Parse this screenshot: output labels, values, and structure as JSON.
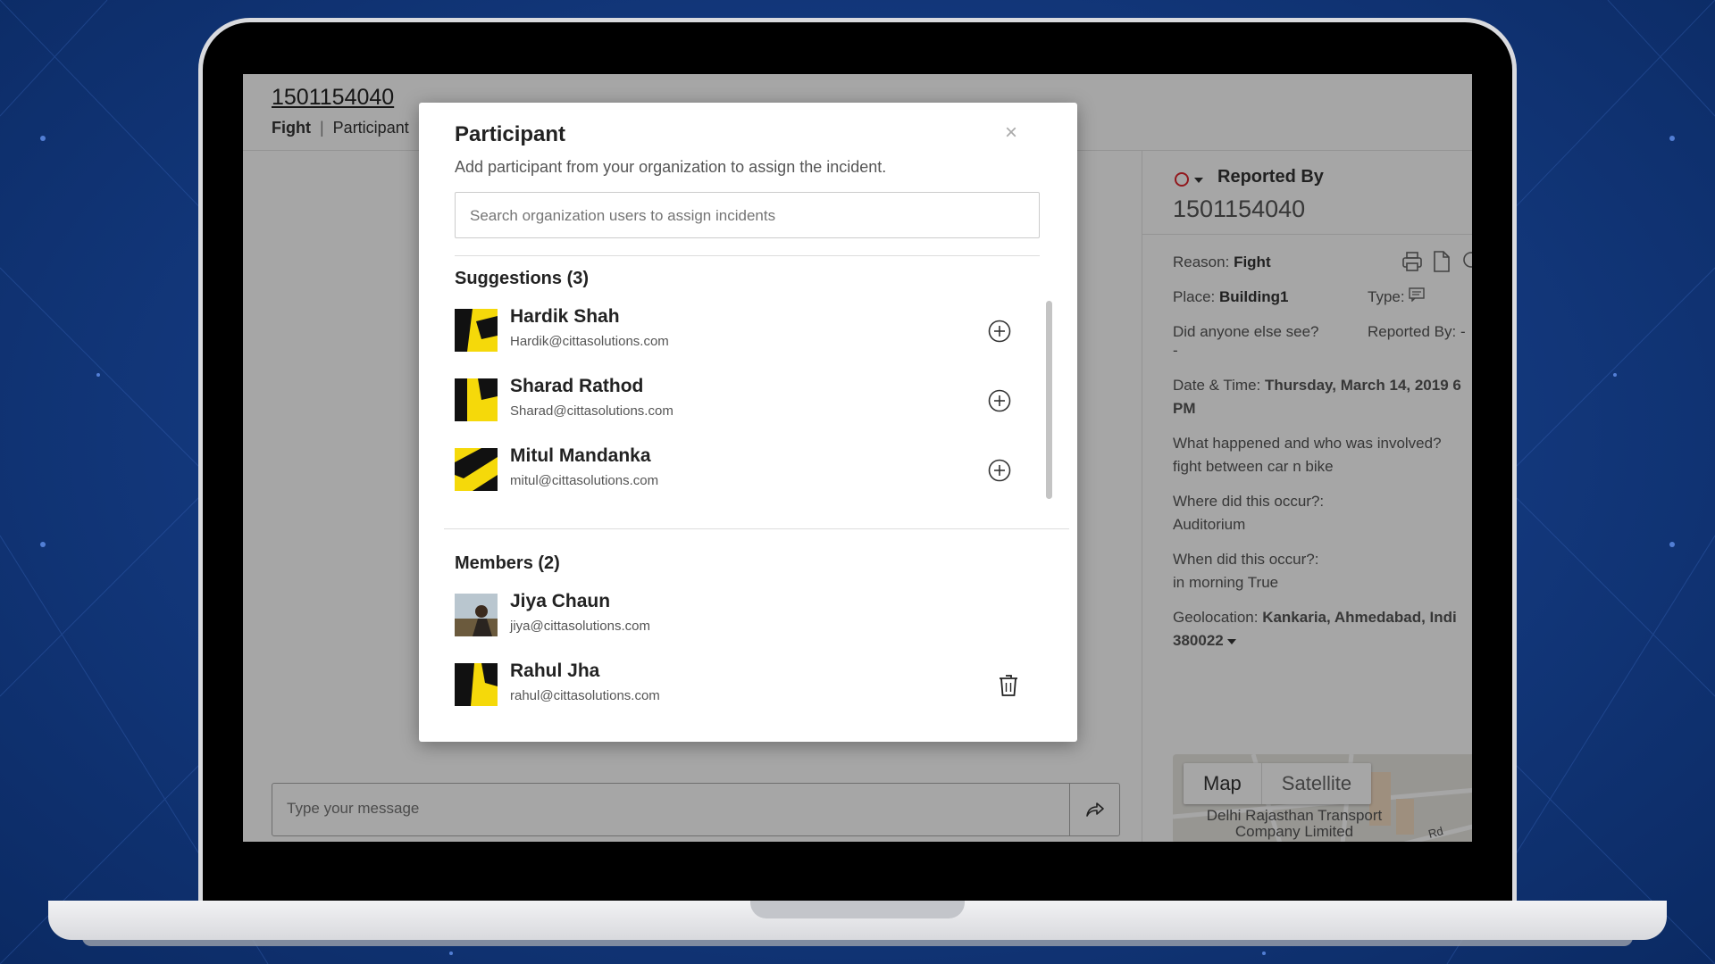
{
  "incident": {
    "id": "1501154040",
    "nav": {
      "active": "Fight",
      "separator": "|",
      "item": "Participant"
    }
  },
  "chat": {
    "message_placeholder": "Type your message",
    "send_icon": "share-arrow-icon"
  },
  "right_panel": {
    "reported_by_title": "Reported By",
    "reported_by_value": "1501154040",
    "status_color": "#e0262d",
    "reason_label": "Reason:",
    "reason_value": "Fight",
    "place_label": "Place:",
    "place_value": "Building1",
    "type_label": "Type:",
    "did_anyone_else_see": "Did anyone else see?",
    "did_anyone_else_see_value": "-",
    "reported_by_label": "Reported By: -",
    "date_time_label": "Date & Time:",
    "date_time_value": "Thursday, March 14, 2019 6",
    "date_time_value2": "PM",
    "what_happened_q": "What happened and who was involved?",
    "what_happened_a": "fight between car n bike",
    "where_q": "Where did this occur?:",
    "where_a": "Auditorium",
    "when_q": "When did this occur?:",
    "when_a": "in morning True",
    "geo_label": "Geolocation:",
    "geo_value": "Kankaria, Ahmedabad, Indi",
    "geo_value2": "380022"
  },
  "map": {
    "tab_map": "Map",
    "tab_satellite": "Satellite",
    "label_line1": "Delhi Rajasthan Transport",
    "label_line2": "Company Limited",
    "road_label": "Rd"
  },
  "modal": {
    "title": "Participant",
    "close": "×",
    "subtitle": "Add participant from your organization to assign the incident.",
    "search_placeholder": "Search organization users to assign incidents",
    "suggestions_title": "Suggestions (3)",
    "members_title": "Members (2)",
    "suggestions": [
      {
        "name": "Hardik Shah",
        "email": "Hardik@cittasolutions.com"
      },
      {
        "name": "Sharad Rathod",
        "email": "Sharad@cittasolutions.com"
      },
      {
        "name": "Mitul Mandanka",
        "email": "mitul@cittasolutions.com"
      }
    ],
    "members": [
      {
        "name": "Jiya Chaun",
        "email": "jiya@cittasolutions.com"
      },
      {
        "name": "Rahul Jha",
        "email": "rahul@cittasolutions.com"
      }
    ]
  },
  "colors": {
    "background": "#143a80",
    "avatar_yellow": "#f5d90a",
    "accent_red": "#e0262d"
  }
}
